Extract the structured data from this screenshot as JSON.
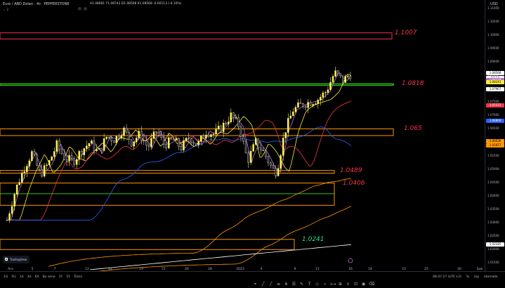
{
  "header": {
    "symbol": "Euro / ABD Doları · 4s · PEPPERSTONE",
    "ohlc": "A1.08681  Y1.08742  D1.08508  K1.08568  -0.00113 (-0.10%)",
    "collapse_label": "⌄ 2"
  },
  "axis": {
    "currency": "USD",
    "price_ticks": [
      "1.11000",
      "1.10500",
      "1.10000",
      "1.09500",
      "1.09000",
      "1.08500",
      "1.08000",
      "1.07500",
      "1.07000",
      "1.06500",
      "1.06000",
      "1.05500",
      "1.05000",
      "1.04500",
      "1.04000",
      "1.03500",
      "1.03000",
      "1.02500",
      "1.02000",
      "1.01500"
    ],
    "price_badges": [
      {
        "text": "1.08568",
        "bg": "#ffffff",
        "fg": "#000000"
      },
      {
        "text": "12:13",
        "bg": "#ffffff",
        "fg": "#000000"
      },
      {
        "text": "1.08329",
        "bg": "#b86ad9",
        "fg": "#ffffff"
      },
      {
        "text": "1.08245",
        "bg": "#ffeb3b",
        "fg": "#000000"
      },
      {
        "text": "1.07967",
        "bg": "#ffffff",
        "fg": "#000000"
      },
      {
        "text": "1.07371",
        "bg": "#f23645",
        "fg": "#ffffff"
      },
      {
        "text": "1.06809",
        "bg": "#2962ff",
        "fg": "#ffffff"
      },
      {
        "text": "1.06036",
        "bg": "#ff9800",
        "fg": "#000000"
      },
      {
        "text": "1.05877",
        "bg": "#ff9800",
        "fg": "#000000"
      },
      {
        "text": "1.02185",
        "bg": "#ffffff",
        "fg": "#000000"
      }
    ],
    "time_ticks": [
      "Ara",
      "5",
      "7",
      "12",
      "14",
      "19",
      "21",
      "26",
      "28",
      "2023",
      "4",
      "9",
      "11",
      "16",
      "18",
      "23",
      "25",
      "30",
      "Şub"
    ]
  },
  "levels": [
    {
      "label": "1.1007",
      "color": "#f23645"
    },
    {
      "label": "1.0818",
      "color": "#f23645"
    },
    {
      "label": "1.065",
      "color": "#f23645"
    },
    {
      "label": "1.0489",
      "color": "#f23645"
    },
    {
      "label": "1.0406",
      "color": "#f23645"
    },
    {
      "label": "1.0241",
      "color": "#22e08a"
    }
  ],
  "bottom": {
    "timeframes": [
      "1G",
      "5G",
      "1A",
      "3A",
      "6A",
      "Bu sene",
      "1Y",
      "5Y",
      "Tümü"
    ],
    "clock": "08:47:27 (UTC+3)",
    "pct": "%",
    "log": "log",
    "auto": "otomatik",
    "logo_text": "TradingView"
  },
  "chart_data": {
    "type": "candlestick",
    "symbol": "EURUSD",
    "timeframe": "4h",
    "ylim": [
      1.013,
      1.112
    ],
    "y_ticks": [
      1.11,
      1.105,
      1.1,
      1.095,
      1.09,
      1.085,
      1.08,
      1.075,
      1.07,
      1.065,
      1.06,
      1.055,
      1.05,
      1.045,
      1.04,
      1.035,
      1.03,
      1.025,
      1.02,
      1.015
    ],
    "zones": [
      {
        "label": "1.1007",
        "low": 1.0985,
        "high": 1.1008,
        "color": "#f23645"
      },
      {
        "label": "1.0818",
        "low": 1.0813,
        "high": 1.0818,
        "color": "#39ff14"
      },
      {
        "label": "1.065",
        "low": 1.0625,
        "high": 1.065,
        "color": "#ff9800"
      },
      {
        "label": "1.0489",
        "low": 1.0485,
        "high": 1.0495,
        "color": "#ff9800"
      },
      {
        "label": "1.0406",
        "low": 1.0365,
        "high": 1.0448,
        "color": "#ff9800"
      },
      {
        "label": "1.0241",
        "low": 1.02,
        "high": 1.0238,
        "color": "#ff9800"
      }
    ],
    "close_path": [
      {
        "t": 0,
        "v": 1.031
      },
      {
        "t": 4,
        "v": 1.042
      },
      {
        "t": 8,
        "v": 1.05
      },
      {
        "t": 12,
        "v": 1.056
      },
      {
        "t": 16,
        "v": 1.048
      },
      {
        "t": 20,
        "v": 1.052
      },
      {
        "t": 24,
        "v": 1.059
      },
      {
        "t": 28,
        "v": 1.054
      },
      {
        "t": 32,
        "v": 1.053
      },
      {
        "t": 36,
        "v": 1.057
      },
      {
        "t": 40,
        "v": 1.06
      },
      {
        "t": 44,
        "v": 1.056
      },
      {
        "t": 48,
        "v": 1.062
      },
      {
        "t": 52,
        "v": 1.061
      },
      {
        "t": 56,
        "v": 1.065
      },
      {
        "t": 60,
        "v": 1.06
      },
      {
        "t": 64,
        "v": 1.063
      },
      {
        "t": 68,
        "v": 1.058
      },
      {
        "t": 72,
        "v": 1.064
      },
      {
        "t": 76,
        "v": 1.059
      },
      {
        "t": 80,
        "v": 1.061
      },
      {
        "t": 84,
        "v": 1.058
      },
      {
        "t": 88,
        "v": 1.062
      },
      {
        "t": 92,
        "v": 1.059
      },
      {
        "t": 96,
        "v": 1.064
      },
      {
        "t": 100,
        "v": 1.063
      },
      {
        "t": 104,
        "v": 1.066
      },
      {
        "t": 108,
        "v": 1.07
      },
      {
        "t": 112,
        "v": 1.066
      },
      {
        "t": 116,
        "v": 1.053
      },
      {
        "t": 120,
        "v": 1.06
      },
      {
        "t": 124,
        "v": 1.056
      },
      {
        "t": 128,
        "v": 1.05
      },
      {
        "t": 130,
        "v": 1.049
      },
      {
        "t": 134,
        "v": 1.064
      },
      {
        "t": 138,
        "v": 1.072
      },
      {
        "t": 142,
        "v": 1.074
      },
      {
        "t": 146,
        "v": 1.075
      },
      {
        "t": 150,
        "v": 1.076
      },
      {
        "t": 154,
        "v": 1.079
      },
      {
        "t": 158,
        "v": 1.086
      },
      {
        "t": 162,
        "v": 1.083
      },
      {
        "t": 166,
        "v": 1.0857
      }
    ],
    "moving_averages": [
      {
        "color": "#b86ad9",
        "last": 1.08329
      },
      {
        "color": "#ffeb3b",
        "last": 1.08245
      },
      {
        "color": "#f23645",
        "last": 1.07371
      },
      {
        "color": "#2962ff",
        "last": 1.06809
      },
      {
        "color": "#ff9800",
        "last": 1.06036
      },
      {
        "color": "#ff9800",
        "last": 1.05877
      },
      {
        "color": "#ffffff",
        "last": 1.02185
      }
    ]
  }
}
